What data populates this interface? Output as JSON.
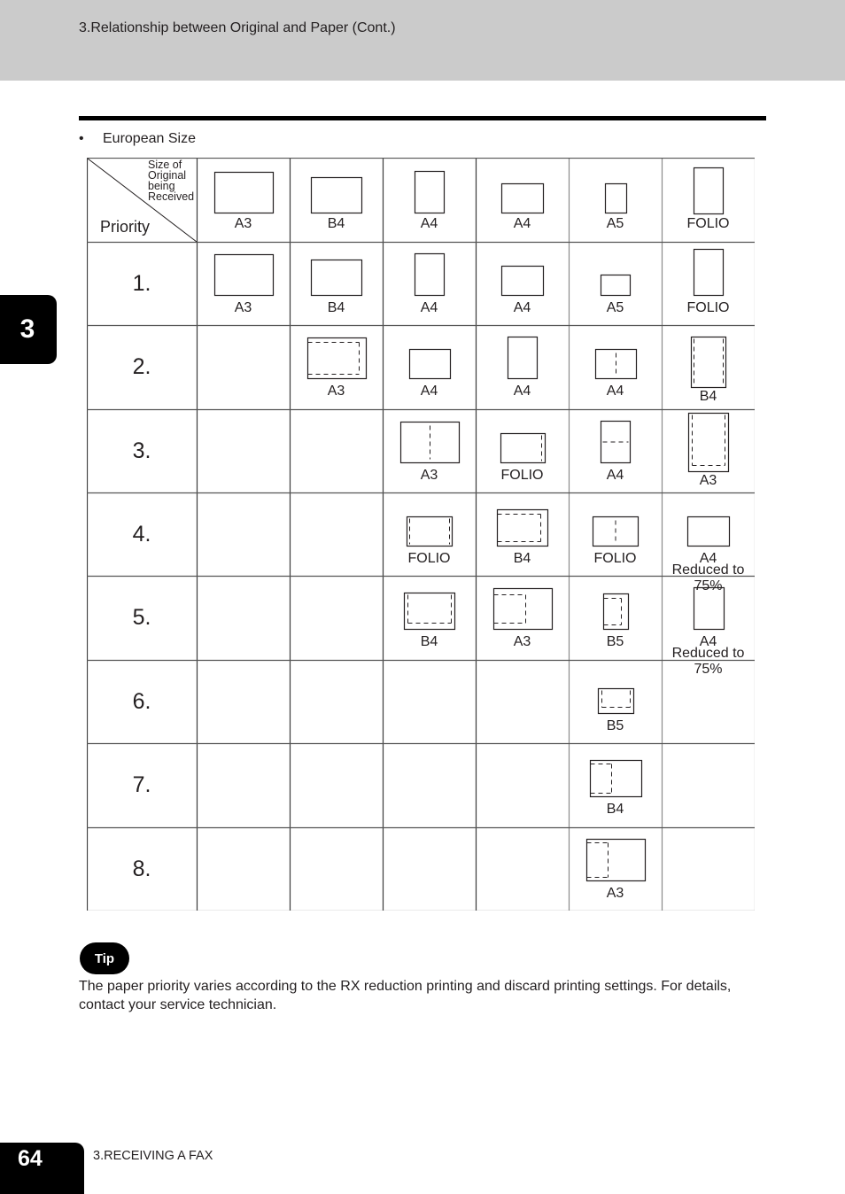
{
  "header": {
    "title": "3.Relationship between Original and Paper (Cont.)"
  },
  "chapter_tab": "3",
  "section": {
    "bullet": "•",
    "label": "European Size"
  },
  "table": {
    "corner_top_lines": [
      "Size of",
      "Original",
      "being",
      "Received"
    ],
    "corner_bottom": "Priority",
    "columns": [
      {
        "label": "A3",
        "shape": "landscape-lg"
      },
      {
        "label": "B4",
        "shape": "landscape-md"
      },
      {
        "label": "A4",
        "shape": "portrait-a4"
      },
      {
        "label": "A4",
        "shape": "landscape-a4"
      },
      {
        "label": "A5",
        "shape": "portrait-a5"
      },
      {
        "label": "FOLIO",
        "shape": "portrait-folio"
      }
    ],
    "rows": [
      {
        "priority": "1.",
        "cells": [
          {
            "label": "A3",
            "shape": "landscape-lg",
            "marks": []
          },
          {
            "label": "B4",
            "shape": "landscape-md",
            "marks": []
          },
          {
            "label": "A4",
            "shape": "portrait-a4",
            "marks": []
          },
          {
            "label": "A4",
            "shape": "landscape-a4",
            "marks": []
          },
          {
            "label": "A5",
            "shape": "landscape-a5",
            "marks": []
          },
          {
            "label": "FOLIO",
            "shape": "portrait-folio",
            "marks": []
          }
        ]
      },
      {
        "priority": "2.",
        "cells": [
          null,
          {
            "label": "A3",
            "shape": "landscape-lg",
            "marks": [
              "inner-top-right-bottom"
            ]
          },
          {
            "label": "A4",
            "shape": "landscape-a4s",
            "marks": []
          },
          {
            "label": "A4",
            "shape": "portrait-a4",
            "marks": []
          },
          {
            "label": "A4",
            "shape": "landscape-a4s",
            "marks": [
              "vertical-center"
            ]
          },
          {
            "label": "B4",
            "shape": "portrait-b4",
            "marks": [
              "vertical-sides"
            ]
          }
        ]
      },
      {
        "priority": "3.",
        "cells": [
          null,
          null,
          {
            "label": "A3",
            "shape": "landscape-lg",
            "marks": [
              "vertical-center"
            ]
          },
          {
            "label": "FOLIO",
            "shape": "landscape-folio",
            "marks": [
              "vertical-right"
            ]
          },
          {
            "label": "A4",
            "shape": "portrait-a4",
            "marks": [
              "horizontal-center"
            ]
          },
          {
            "label": "A3",
            "shape": "portrait-a3",
            "marks": [
              "inner-left-right-bottom"
            ]
          }
        ]
      },
      {
        "priority": "4.",
        "cells": [
          null,
          null,
          {
            "label": "FOLIO",
            "shape": "landscape-folio2",
            "marks": [
              "vertical-sides"
            ]
          },
          {
            "label": "B4",
            "shape": "landscape-b4",
            "marks": [
              "inner-top-right-bottom"
            ]
          },
          {
            "label": "FOLIO",
            "shape": "landscape-folio2",
            "marks": [
              "vertical-center"
            ]
          },
          {
            "label": "A4",
            "sublabel": "Reduced to 75%",
            "shape": "landscape-r75",
            "marks": []
          }
        ]
      },
      {
        "priority": "5.",
        "cells": [
          null,
          null,
          {
            "label": "B4",
            "shape": "landscape-b4b",
            "marks": [
              "inner-left-right-bottom"
            ]
          },
          {
            "label": "A3",
            "shape": "landscape-lg",
            "marks": [
              "inner-top-right-bottom-left"
            ]
          },
          {
            "label": "B5",
            "shape": "portrait-b5",
            "marks": [
              "inner-top-right-bottom"
            ]
          },
          {
            "label": "A4",
            "sublabel": "Reduced to 75%",
            "shape": "portrait-r75",
            "marks": []
          }
        ]
      },
      {
        "priority": "6.",
        "cells": [
          null,
          null,
          null,
          null,
          {
            "label": "B5",
            "shape": "landscape-b5",
            "marks": [
              "inner-left-right-bottom"
            ]
          },
          null
        ]
      },
      {
        "priority": "7.",
        "cells": [
          null,
          null,
          null,
          null,
          {
            "label": "B4",
            "shape": "landscape-b4c",
            "marks": [
              "inner-left-box"
            ]
          },
          null
        ]
      },
      {
        "priority": "8.",
        "cells": [
          null,
          null,
          null,
          null,
          {
            "label": "A3",
            "shape": "landscape-lg2",
            "marks": [
              "inner-left-box"
            ]
          },
          null
        ]
      }
    ]
  },
  "tip": {
    "badge": "Tip",
    "text": "The paper priority varies according to the RX reduction printing and discard printing settings. For details, contact your service technician."
  },
  "footer": {
    "page_number": "64",
    "chapter": "3.RECEIVING A FAX"
  }
}
